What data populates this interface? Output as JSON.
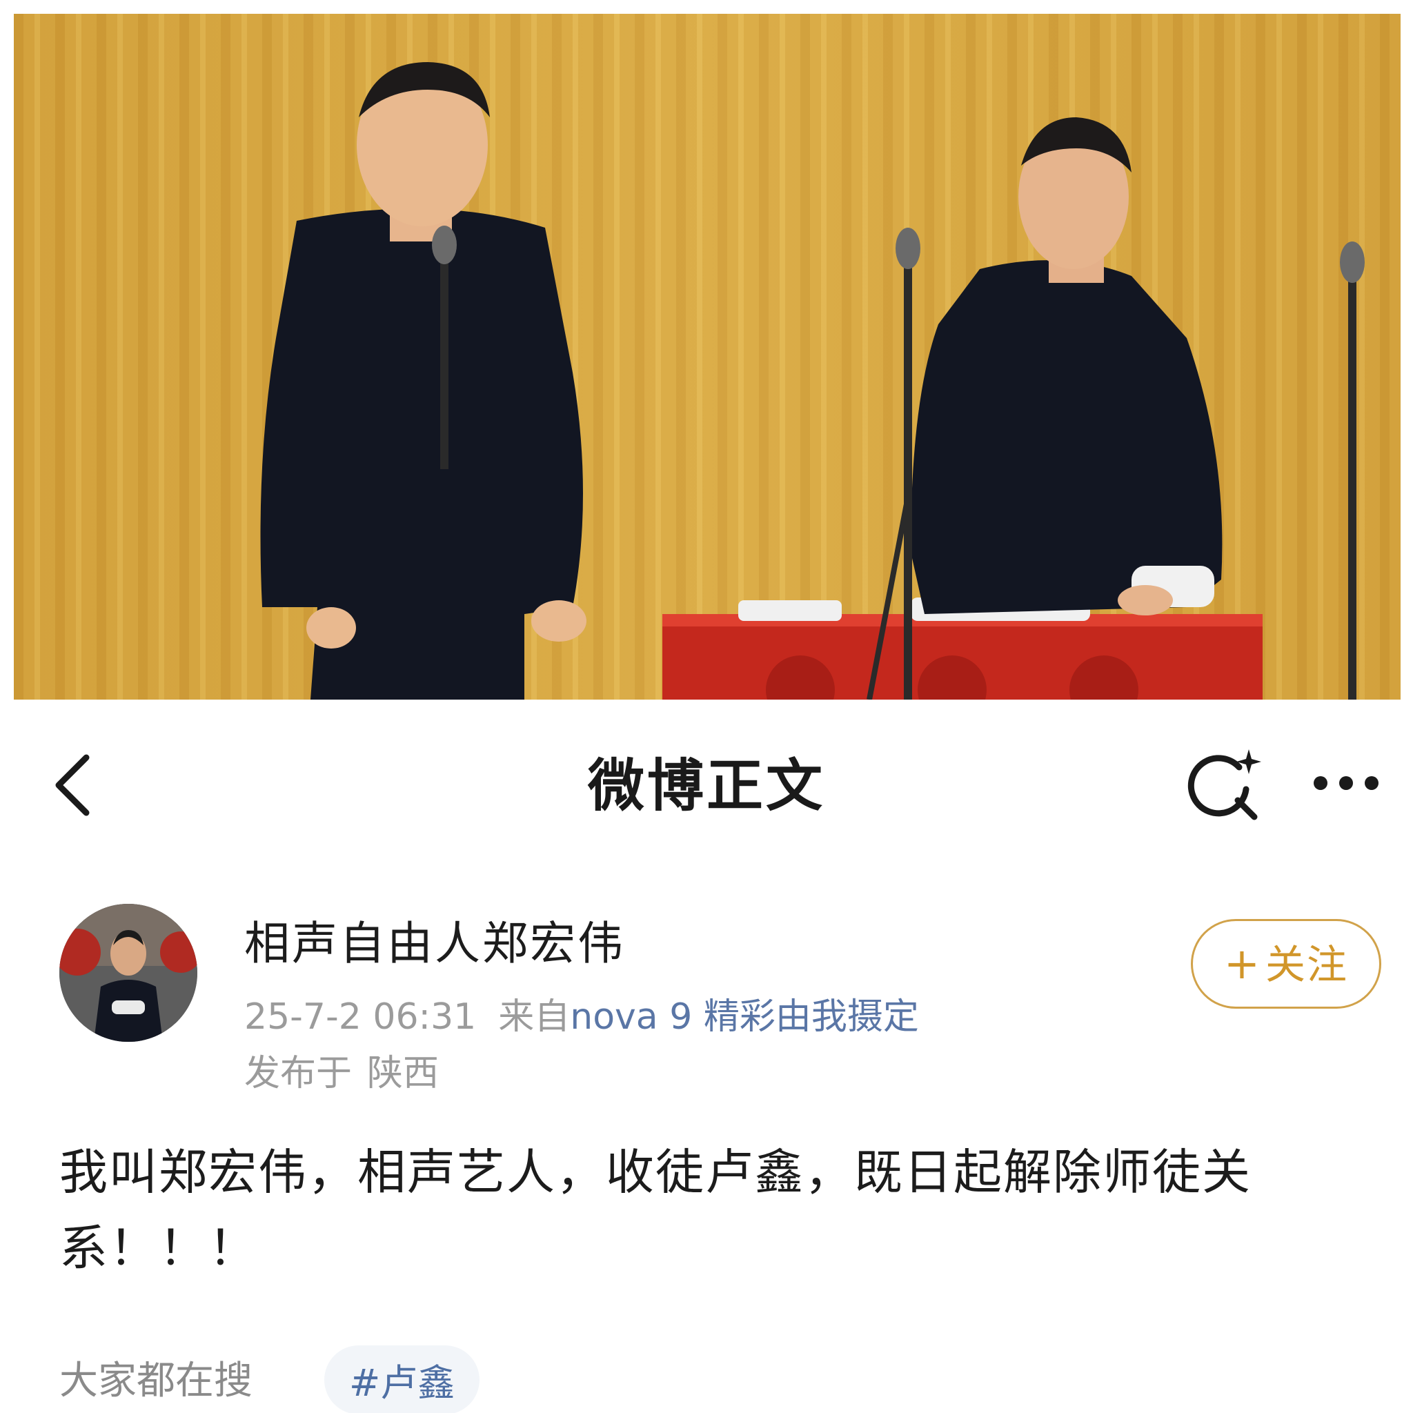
{
  "photo": {
    "description_icon": "stage-photo",
    "colors": {
      "curtain": "#d7a840",
      "gown": "#121622",
      "tablecloth": "#c4281d"
    }
  },
  "navbar": {
    "title": "微博正文",
    "back_icon": "chevron-left-icon",
    "search_icon": "search-sparkle-icon",
    "more_icon": "more-dots-icon"
  },
  "author": {
    "name": "相声自由人郑宏伟",
    "time": "25-7-2 06:31",
    "source_prefix": "来自",
    "device": "nova 9 精彩由我摄定",
    "location_prefix": "发布于",
    "location": "陕西",
    "follow_plus": "+",
    "follow_label": "关注"
  },
  "post": {
    "text": "我叫郑宏伟，相声艺人，收徒卢鑫，既日起解除师徒关系！！！"
  },
  "trending": {
    "label": "大家都在搜",
    "hashtag": "#卢鑫"
  },
  "colors": {
    "accent_follow": "#d1962a",
    "link_blue": "#5a76a6",
    "meta_gray": "#9b9b9b"
  }
}
